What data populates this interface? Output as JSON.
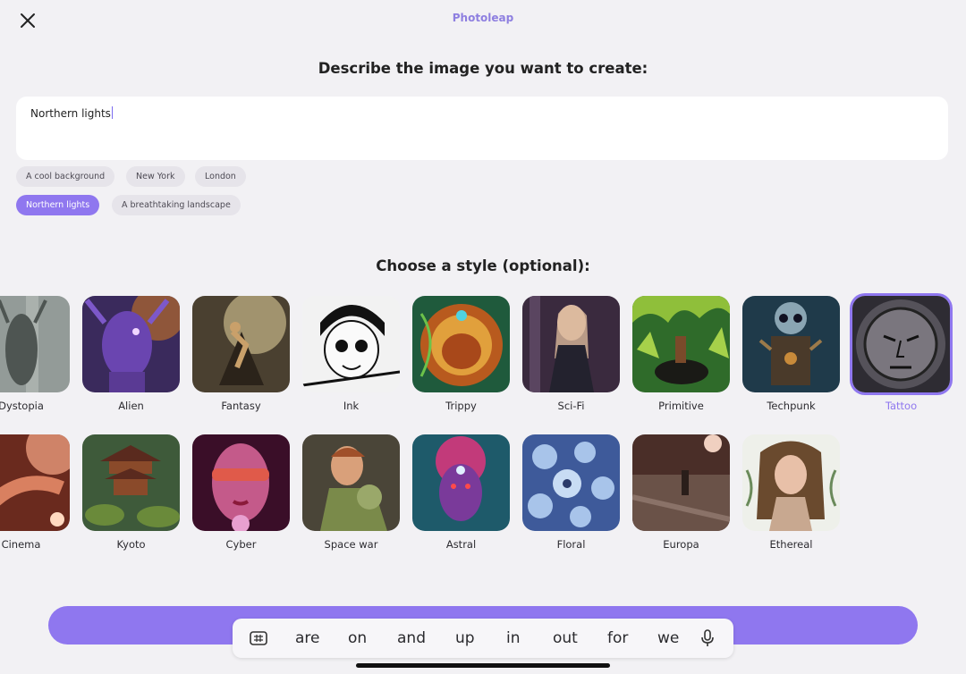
{
  "header": {
    "app_title": "Photoleap"
  },
  "describe": {
    "heading": "Describe the image you want to create:",
    "prompt_value": "Northern lights"
  },
  "suggestions": [
    {
      "label": "A cool background",
      "active": false
    },
    {
      "label": "New York",
      "active": false
    },
    {
      "label": "London",
      "active": false
    },
    {
      "label": "Northern lights",
      "active": true
    },
    {
      "label": "A breathtaking landscape",
      "active": false
    }
  ],
  "styles": {
    "heading": "Choose a style (optional):",
    "selected": "Tattoo",
    "row1": [
      "Dystopia",
      "Alien",
      "Fantasy",
      "Ink",
      "Trippy",
      "Sci-Fi",
      "Primitive",
      "Techpunk",
      "Tattoo"
    ],
    "row2": [
      "Cinema",
      "Kyoto",
      "Cyber",
      "Space war",
      "Astral",
      "Floral",
      "Europa",
      "Ethereal"
    ]
  },
  "keyboard": {
    "suggestions": [
      "are",
      "on",
      "and",
      "up",
      "in",
      "out",
      "for",
      "we"
    ],
    "left_icon": "grid-keyboard-icon",
    "right_icon": "microphone-icon"
  },
  "colors": {
    "accent": "#8f77ef",
    "background": "#f2f1f4"
  }
}
